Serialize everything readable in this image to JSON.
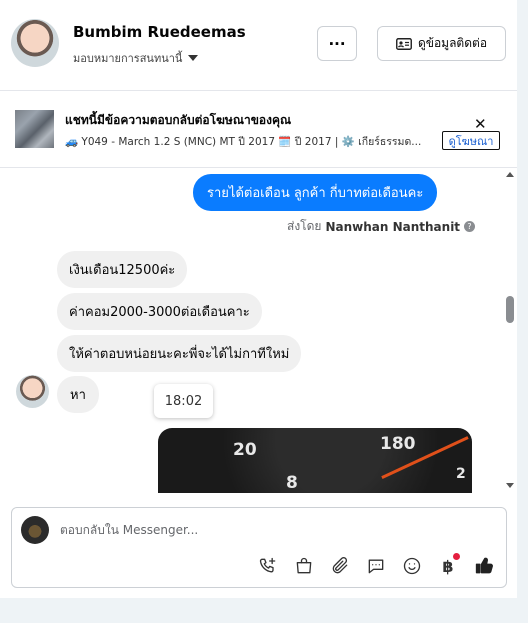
{
  "header": {
    "name": "Bumbim Ruedeemas",
    "assign_label": "มอบหมายการสนทนานี้",
    "more_label": "···",
    "contact_button": "ดูข้อมูลติดต่อ"
  },
  "ad": {
    "title": "แชทนี้มีข้อความตอบกลับต่อโฆษณาของคุณ",
    "subtitle": "🚙 Y049 - March 1.2 S (MNC) MT ปี 2017 🗓️ ปี 2017 | ⚙️ เกียร์ธรรมด...",
    "view_ad": "ดูโฆษณา",
    "close": "✕"
  },
  "chat": {
    "outgoing": "รายได้ต่อเดือน  ลูกค้า กี่บาทต่อเดือนคะ",
    "sent_by_prefix": "ส่งโดย",
    "sent_by_name": "Nanwhan Nanthanit",
    "sent_by_help": "?",
    "incoming": [
      "เงินเดือน12500ค่ะ",
      "ค่าคอม2000-3000ต่อเดือนคาะ",
      "ให้ค่าตอบหน่อยนะคะพี่จะได้ไม่กาทีใหม่",
      "หา"
    ],
    "tooltip_time": "18:02",
    "photo_labels": [
      "20",
      "180",
      "8",
      "2"
    ]
  },
  "composer": {
    "placeholder": "ตอบกลับใน Messenger...",
    "tools": [
      "call-add-icon",
      "shopping-bag-icon",
      "paperclip-icon",
      "saved-reply-icon",
      "emoji-icon",
      "baht-payment-icon",
      "thumbs-up-icon"
    ],
    "baht_symbol": "฿"
  },
  "colors": {
    "accent": "#0a7cff",
    "incoming_bubble": "#f0f0f0",
    "notification_dot": "#e41e3f"
  }
}
